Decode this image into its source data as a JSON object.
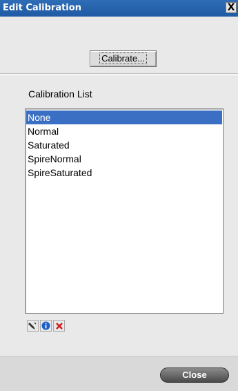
{
  "window": {
    "title": "Edit Calibration",
    "close_symbol": "X"
  },
  "toolbar": {
    "calibrate_label": "Calibrate..."
  },
  "calibration_list": {
    "label": "Calibration List",
    "items": [
      "None",
      "Normal",
      "Saturated",
      "SpireNormal",
      "SpireSaturated"
    ],
    "selected": "None"
  },
  "icons": {
    "edit": "edit-icon",
    "info": "info-icon",
    "delete": "delete-icon"
  },
  "footer": {
    "close_label": "Close"
  },
  "colors": {
    "titlebar": "#2a67b1",
    "selection": "#3a6fc4",
    "info_icon": "#1d5fc7",
    "delete_icon": "#d01818"
  }
}
